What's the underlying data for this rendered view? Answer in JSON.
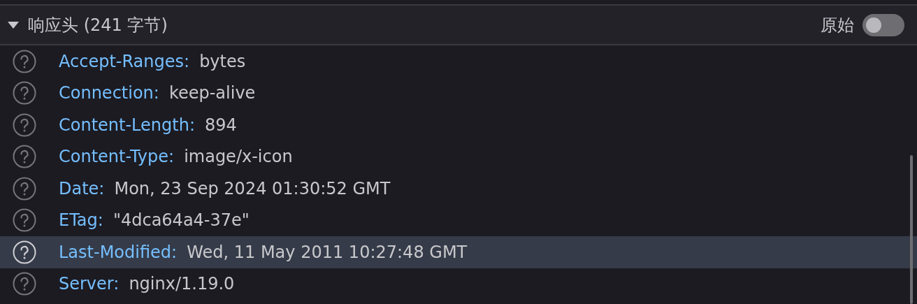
{
  "section": {
    "title": "响应头 (241 字节)",
    "expanded": true,
    "raw_toggle": {
      "label": "原始",
      "on": false
    }
  },
  "headers": [
    {
      "name": "Accept-Ranges:",
      "value": "bytes",
      "selected": false
    },
    {
      "name": "Connection:",
      "value": "keep-alive",
      "selected": false
    },
    {
      "name": "Content-Length:",
      "value": "894",
      "selected": false
    },
    {
      "name": "Content-Type:",
      "value": "image/x-icon",
      "selected": false
    },
    {
      "name": "Date:",
      "value": "Mon, 23 Sep 2024 01:30:52 GMT",
      "selected": false
    },
    {
      "name": "ETag:",
      "value": "\"4dca64a4-37e\"",
      "selected": false
    },
    {
      "name": "Last-Modified:",
      "value": "Wed, 11 May 2011 10:27:48 GMT",
      "selected": true
    },
    {
      "name": "Server:",
      "value": "nginx/1.19.0",
      "selected": false
    }
  ]
}
